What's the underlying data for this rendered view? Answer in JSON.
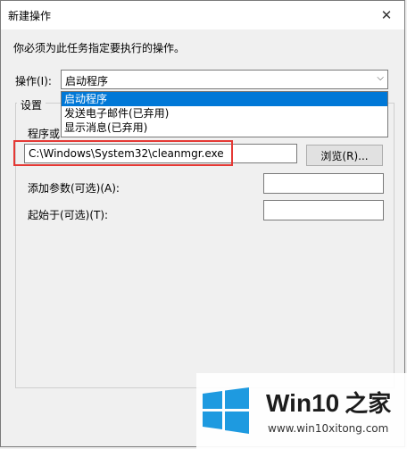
{
  "window": {
    "title": "新建操作",
    "close_glyph": "✕"
  },
  "instruction": "你必须为此任务指定要执行的操作。",
  "operation": {
    "label": "操作(I):",
    "value": "启动程序",
    "arrow_glyph": "⌵"
  },
  "dropdown": {
    "options": [
      "启动程序",
      "发送电子邮件(已弃用)",
      "显示消息(已弃用)"
    ],
    "selected_index": 0
  },
  "settings": {
    "group_title": "设置",
    "program_label": "程序或",
    "program_value": "C:\\Windows\\System32\\cleanmgr.exe",
    "browse_label": "浏览(R)...",
    "args_label": "添加参数(可选)(A):",
    "args_value": "",
    "start_label": "起始于(可选)(T):",
    "start_value": ""
  },
  "watermark": {
    "brand": "Win10",
    "brand_cn": "之家",
    "url": "www.win10xitong.com"
  },
  "colors": {
    "highlight": "#e53935",
    "selection": "#0078d7",
    "logo": "#1e9ae0"
  }
}
